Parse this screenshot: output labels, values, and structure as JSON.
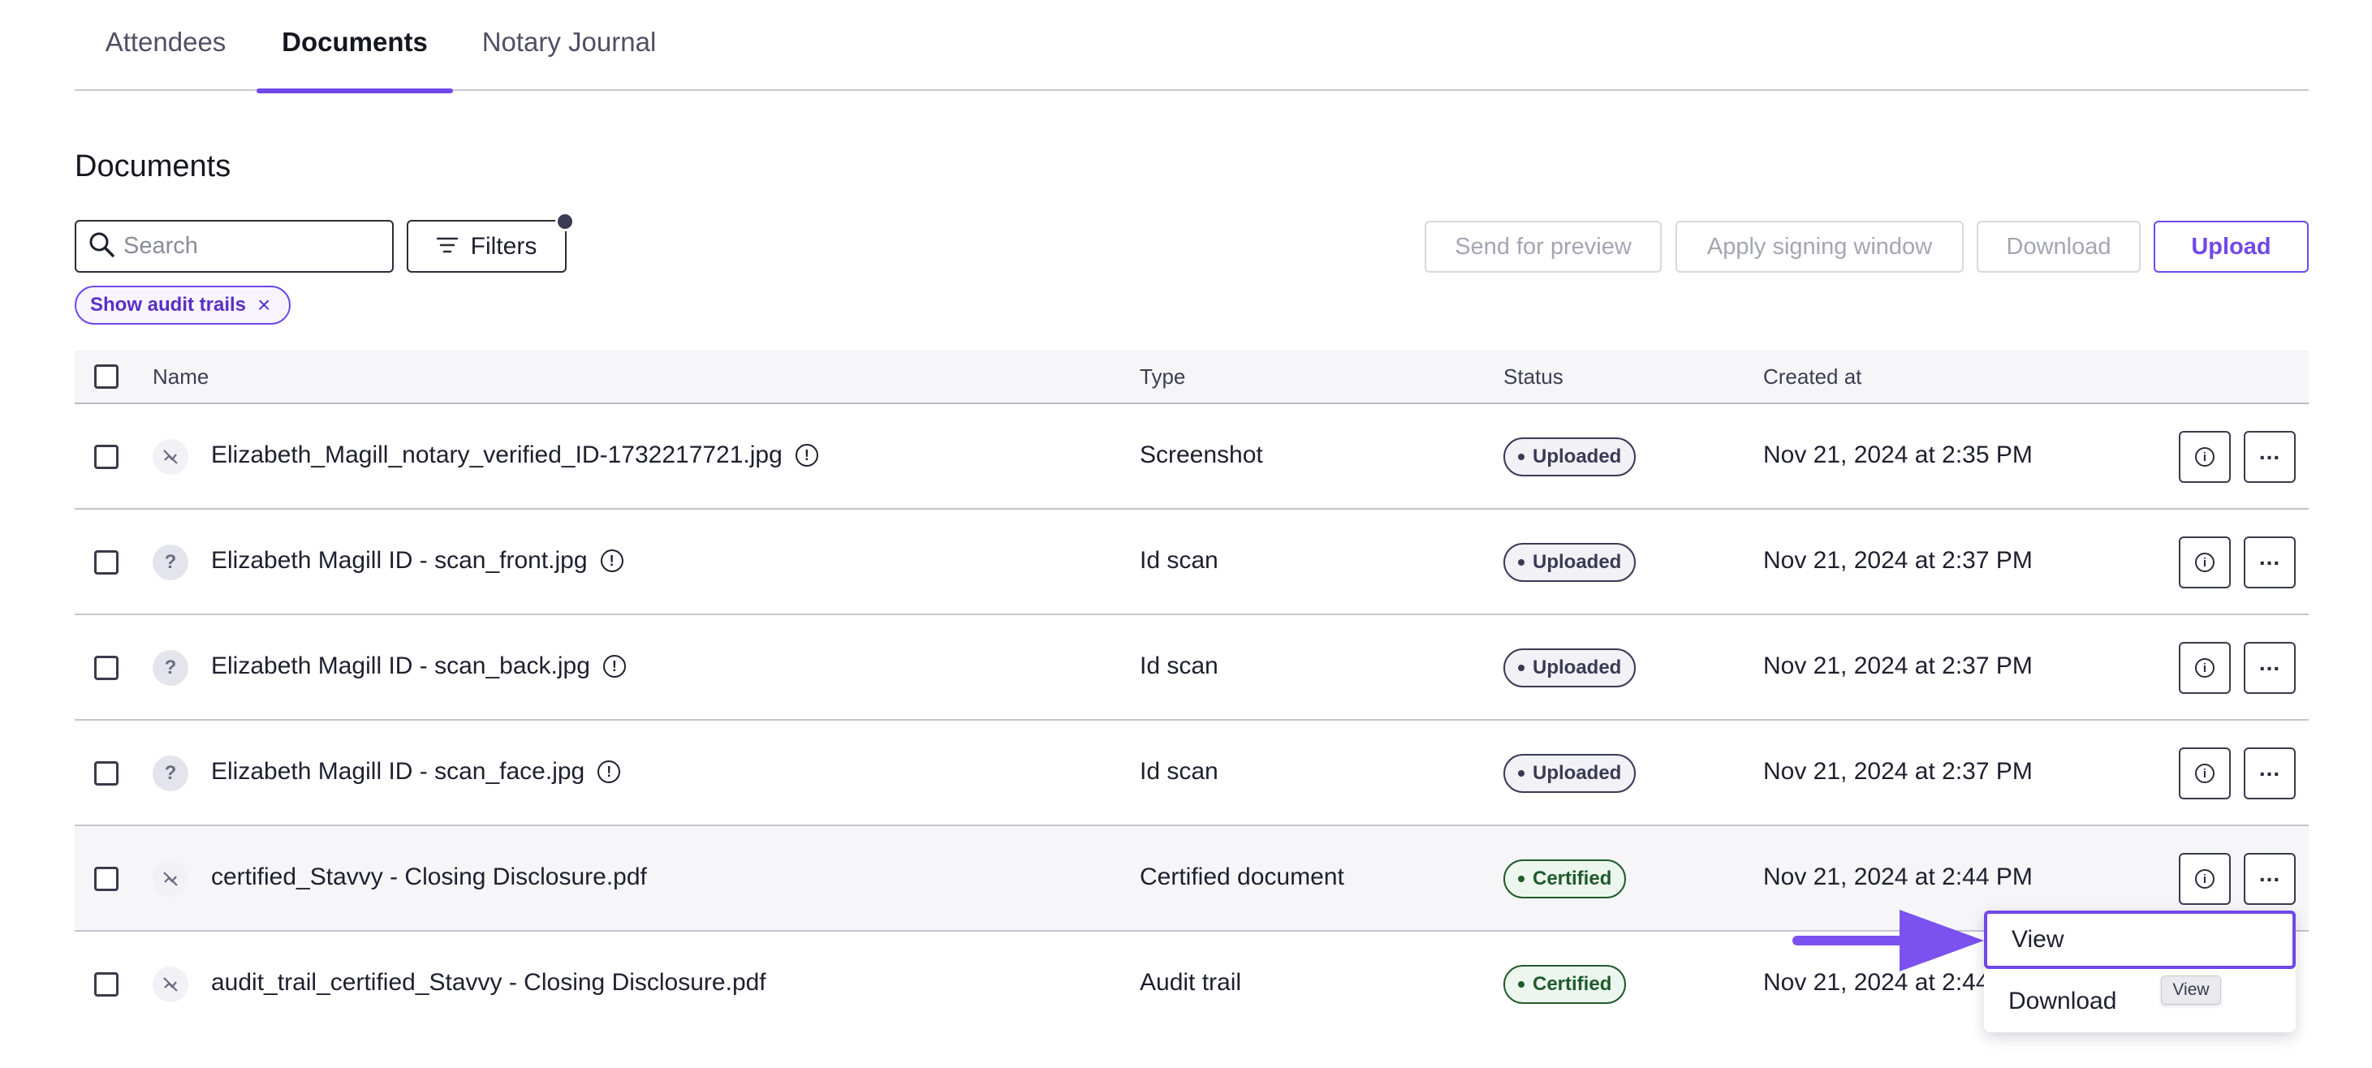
{
  "tabs": [
    {
      "label": "Attendees",
      "active": false
    },
    {
      "label": "Documents",
      "active": true
    },
    {
      "label": "Notary Journal",
      "active": false
    }
  ],
  "section_title": "Documents",
  "toolbar": {
    "search_placeholder": "Search",
    "filters_label": "Filters",
    "send_preview_label": "Send for preview",
    "apply_signing_label": "Apply signing window",
    "download_label": "Download",
    "upload_label": "Upload"
  },
  "chip": {
    "label": "Show audit trails",
    "close": "×"
  },
  "table": {
    "headers": {
      "name": "Name",
      "type": "Type",
      "status": "Status",
      "created": "Created at"
    },
    "rows": [
      {
        "name": "Elizabeth_Magill_notary_verified_ID-1732217721.jpg",
        "type": "Screenshot",
        "status": "Uploaded",
        "created": "Nov 21, 2024 at 2:35 PM",
        "icon": "no-preview-icon",
        "info": true
      },
      {
        "name": "Elizabeth Magill ID - scan_front.jpg",
        "type": "Id scan",
        "status": "Uploaded",
        "created": "Nov 21, 2024 at 2:37 PM",
        "icon": "question-icon",
        "info": true
      },
      {
        "name": "Elizabeth Magill ID - scan_back.jpg",
        "type": "Id scan",
        "status": "Uploaded",
        "created": "Nov 21, 2024 at 2:37 PM",
        "icon": "question-icon",
        "info": true
      },
      {
        "name": "Elizabeth Magill ID - scan_face.jpg",
        "type": "Id scan",
        "status": "Uploaded",
        "created": "Nov 21, 2024 at 2:37 PM",
        "icon": "question-icon",
        "info": true
      },
      {
        "name": "certified_Stavvy - Closing Disclosure.pdf",
        "type": "Certified document",
        "status": "Certified",
        "created": "Nov 21, 2024 at 2:44 PM",
        "icon": "no-preview-icon",
        "info": false
      },
      {
        "name": "audit_trail_certified_Stavvy - Closing Disclosure.pdf",
        "type": "Audit trail",
        "status": "Certified",
        "created": "Nov 21, 2024 at 2:44",
        "icon": "no-preview-icon",
        "info": false
      }
    ]
  },
  "menu": {
    "view": "View",
    "download": "Download",
    "tooltip": "View"
  },
  "colors": {
    "accent": "#7048e8",
    "certified": "#1f5b2c",
    "uploaded": "#3a3a55"
  }
}
